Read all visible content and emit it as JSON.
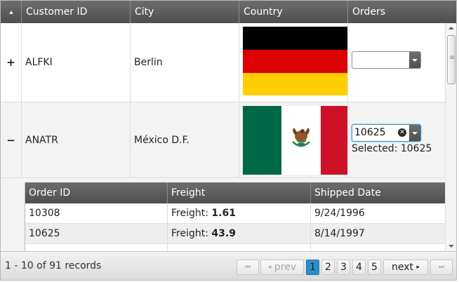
{
  "columns": {
    "customer_id": "Customer ID",
    "city": "City",
    "country": "Country",
    "orders": "Orders"
  },
  "rows": [
    {
      "toggle": "+",
      "customer_id": "ALFKI",
      "city": "Berlin",
      "country_flag": "germany-flag",
      "orders_value": ""
    },
    {
      "toggle": "−",
      "customer_id": "ANATR",
      "city": "México D.F.",
      "country_flag": "mexico-flag",
      "orders_value": "10625",
      "selected_label": "Selected: 10625"
    }
  ],
  "detail": {
    "columns": {
      "order_id": "Order ID",
      "freight": "Freight",
      "shipped_date": "Shipped Date"
    },
    "rows": [
      {
        "order_id": "10308",
        "freight_prefix": "Freight: ",
        "freight_value": "1.61",
        "shipped_date": "9/24/1996"
      },
      {
        "order_id": "10625",
        "freight_prefix": "Freight: ",
        "freight_value": "43.9",
        "shipped_date": "8/14/1997"
      }
    ]
  },
  "pager": {
    "info": "1 - 10 of 91 records",
    "prev": "prev",
    "next": "next",
    "pages": [
      "1",
      "2",
      "3",
      "4",
      "5"
    ],
    "current_page": "1"
  },
  "colors": {
    "header_bg": "#5a5a5a",
    "accent": "#2a8fc6",
    "germany": [
      "#000000",
      "#dd0000",
      "#ffce00"
    ],
    "mexico": [
      "#006847",
      "#ffffff",
      "#ce1126"
    ]
  }
}
